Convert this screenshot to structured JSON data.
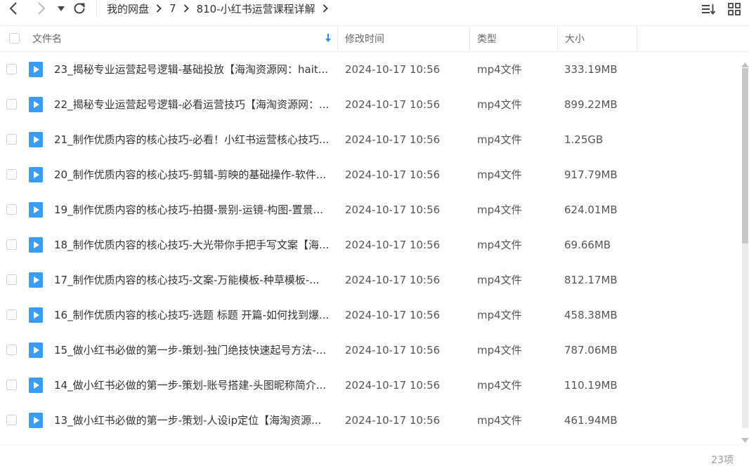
{
  "colors": {
    "accent": "#2d8cf0",
    "file_icon": "#3a9cf5",
    "text": "#333333",
    "muted": "#999999"
  },
  "nav": {
    "back_icon": "chevron-left-icon",
    "forward_icon": "chevron-right-icon",
    "history_icon": "caret-down-icon",
    "refresh_icon": "refresh-icon"
  },
  "breadcrumb": [
    "我的网盘",
    "7",
    "810-小红书运营课程详解"
  ],
  "toolbar": {
    "sort_icon": "sort-icon",
    "grid_icon": "grid-view-icon"
  },
  "header": {
    "name": "文件名",
    "sort_icon": "sort-down-arrow-icon",
    "modified": "修改时间",
    "type": "类型",
    "size": "大小"
  },
  "files": [
    {
      "name": "23_揭秘专业运营起号逻辑-基础投放【海淘资源网：hait...",
      "modified": "2024-10-17 10:56",
      "type": "mp4文件",
      "size": "333.19MB"
    },
    {
      "name": "22_揭秘专业运营起号逻辑-必看运营技巧【海淘资源网：...",
      "modified": "2024-10-17 10:56",
      "type": "mp4文件",
      "size": "899.22MB"
    },
    {
      "name": "21_制作优质内容的核心技巧-必看！小红书运营核心技巧...",
      "modified": "2024-10-17 10:56",
      "type": "mp4文件",
      "size": "1.25GB"
    },
    {
      "name": "20_制作优质内容的核心技巧-剪辑-剪映的基础操作-软件...",
      "modified": "2024-10-17 10:56",
      "type": "mp4文件",
      "size": "917.79MB"
    },
    {
      "name": "19_制作优质内容的核心技巧-拍摄-景别-运镜-构图-置景...",
      "modified": "2024-10-17 10:56",
      "type": "mp4文件",
      "size": "624.01MB"
    },
    {
      "name": "18_制作优质内容的核心技巧-大光带你手把手写文案【海...",
      "modified": "2024-10-17 10:56",
      "type": "mp4文件",
      "size": "69.66MB"
    },
    {
      "name": "17_制作优质内容的核心技巧-文案-万能模板-种草模板-...",
      "modified": "2024-10-17 10:56",
      "type": "mp4文件",
      "size": "812.17MB"
    },
    {
      "name": "16_制作优质内容的核心技巧-选题 标题 开篇-如何找到爆...",
      "modified": "2024-10-17 10:56",
      "type": "mp4文件",
      "size": "458.38MB"
    },
    {
      "name": "15_做小红书必做的第一步-策划-独门绝技快速起号方法-...",
      "modified": "2024-10-17 10:56",
      "type": "mp4文件",
      "size": "787.06MB"
    },
    {
      "name": "14_做小红书必做的第一步-策划-账号搭建-头图昵称简介...",
      "modified": "2024-10-17 10:56",
      "type": "mp4文件",
      "size": "110.19MB"
    },
    {
      "name": "13_做小红书必做的第一步-策划-人设ip定位【海淘资源...",
      "modified": "2024-10-17 10:56",
      "type": "mp4文件",
      "size": "461.94MB"
    }
  ],
  "footer": {
    "count": "23项"
  }
}
